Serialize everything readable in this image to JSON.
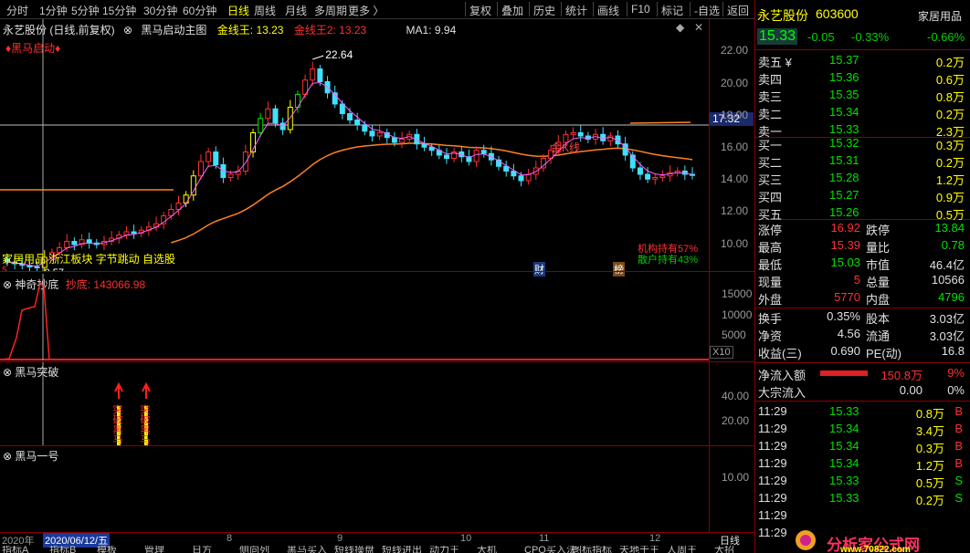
{
  "toolbar": {
    "timeframes": [
      "分时",
      "1分钟",
      "5分钟",
      "15分钟",
      "30分钟",
      "60分钟",
      "日线",
      "周线",
      "月线",
      "多周期",
      "更多 〉"
    ],
    "active_timeframe": "日线",
    "buttons": [
      "复权",
      "叠加",
      "历史",
      "统计",
      "画线",
      "F10",
      "标记",
      "-自选",
      "返回"
    ]
  },
  "main_chart": {
    "title": "永艺股份 (日线,前复权)",
    "indicator_name": "黑马启动主图",
    "gold_line_label": "金线王: 13.23",
    "gold_line2_label": "金线王2: 13.23",
    "ma_label": "MA1: 9.94",
    "start_signal": "♦黑马启动♦",
    "high_label": "22.64",
    "low_label": "9.57",
    "current_price_tag": "17.32",
    "kline_text": "金K线",
    "concepts": "家居用品 浙江板块 字节跳动 自选股",
    "inst_holding": "机构持有57%",
    "retail_holding": "散户持有43%",
    "marker_cai": "财",
    "marker_bang": "榜",
    "marker_s": "s",
    "y_ticks": [
      "22.00",
      "20.00",
      "18.00",
      "16.00",
      "14.00",
      "12.00",
      "10.00"
    ]
  },
  "sub1": {
    "title": "神奇抄底",
    "label": "抄底: 143066.98",
    "y_ticks": [
      "15000",
      "10000",
      "5000"
    ],
    "scale": "X10"
  },
  "sub2": {
    "title": "黑马突破",
    "signal_text": "突破黑马",
    "y_ticks": [
      "40.00",
      "20.00"
    ]
  },
  "sub3": {
    "title": "黑马一号",
    "y_ticks": [
      "10.00"
    ]
  },
  "xaxis": {
    "year": "2020年",
    "cursor_date": "2020/06/12/五",
    "months": [
      "8",
      "9",
      "10",
      "11",
      "12"
    ],
    "period": "日线"
  },
  "bottom_tabs": [
    "指标A",
    "指标B",
    "模板",
    "管理",
    "日方",
    "侧向列",
    "黑马买入",
    "短线操盘",
    "短线进出",
    "动力王",
    "大机",
    "CPO买入法",
    "图标指标",
    "天地于王",
    "人周王",
    "大招"
  ],
  "quote": {
    "name": "永艺股份",
    "code": "603600",
    "industry": "家居用品",
    "price": "15.33",
    "change": "-0.05",
    "change_pct": "-0.33%",
    "industry_pct": "-0.66%",
    "asks": [
      {
        "label": "卖五 ¥",
        "price": "15.37",
        "vol": "0.2万"
      },
      {
        "label": "卖四",
        "price": "15.36",
        "vol": "0.6万"
      },
      {
        "label": "卖三",
        "price": "15.35",
        "vol": "0.8万"
      },
      {
        "label": "卖二",
        "price": "15.34",
        "vol": "0.2万"
      },
      {
        "label": "卖一",
        "price": "15.33",
        "vol": "2.3万"
      }
    ],
    "bids": [
      {
        "label": "买一",
        "price": "15.32",
        "vol": "0.3万"
      },
      {
        "label": "买二",
        "price": "15.31",
        "vol": "0.2万"
      },
      {
        "label": "买三",
        "price": "15.28",
        "vol": "1.2万"
      },
      {
        "label": "买四",
        "price": "15.27",
        "vol": "0.9万"
      },
      {
        "label": "买五",
        "price": "15.26",
        "vol": "0.5万"
      }
    ],
    "stats": [
      {
        "l1": "涨停",
        "v1": "16.92",
        "l2": "跌停",
        "v2": "13.84",
        "c1": "red",
        "c2": "green"
      },
      {
        "l1": "最高",
        "v1": "15.39",
        "l2": "量比",
        "v2": "0.78",
        "c1": "red",
        "c2": "green"
      },
      {
        "l1": "最低",
        "v1": "15.03",
        "l2": "市值",
        "v2": "46.4亿",
        "c1": "green",
        "c2": "white"
      },
      {
        "l1": "现量",
        "v1": "5",
        "l2": "总量",
        "v2": "10566",
        "c1": "red",
        "c2": "white"
      },
      {
        "l1": "外盘",
        "v1": "5770",
        "l2": "内盘",
        "v2": "4796",
        "c1": "red",
        "c2": "green"
      }
    ],
    "stats2": [
      {
        "l1": "换手",
        "v1": "0.35%",
        "l2": "股本",
        "v2": "3.03亿"
      },
      {
        "l1": "净资",
        "v1": "4.56",
        "l2": "流通",
        "v2": "3.03亿"
      },
      {
        "l1": "收益(三)",
        "v1": "0.690",
        "l2": "PE(动)",
        "v2": "16.8"
      }
    ],
    "net_inflow": {
      "label": "净流入额",
      "value": "150.8万",
      "pct": "9%"
    },
    "block_inflow": {
      "label": "大宗流入",
      "value": "0.00",
      "pct": "0%"
    },
    "ticks": [
      {
        "time": "11:29",
        "price": "15.33",
        "vol": "0.8万",
        "side": "B"
      },
      {
        "time": "11:29",
        "price": "15.34",
        "vol": "3.4万",
        "side": "B"
      },
      {
        "time": "11:29",
        "price": "15.34",
        "vol": "0.3万",
        "side": "B"
      },
      {
        "time": "11:29",
        "price": "15.34",
        "vol": "1.2万",
        "side": "B"
      },
      {
        "time": "11:29",
        "price": "15.33",
        "vol": "0.5万",
        "side": "S"
      },
      {
        "time": "11:29",
        "price": "15.33",
        "vol": "0.2万",
        "side": "S"
      },
      {
        "time": "11:29",
        "price": "",
        "vol": "",
        "side": ""
      },
      {
        "time": "11:29",
        "price": "",
        "vol": "",
        "side": ""
      }
    ],
    "watermark": "分析家公式网",
    "watermark_url": "www.70822.com"
  },
  "chart_data": {
    "type": "candlestick",
    "title": "永艺股份 (日线,前复权)",
    "ylim": [
      9,
      23
    ],
    "x_months": [
      "8",
      "9",
      "10",
      "11",
      "12"
    ],
    "closes": [
      9.9,
      9.8,
      9.7,
      9.6,
      9.57,
      10.2,
      10.5,
      10.8,
      11.2,
      11.0,
      11.3,
      11.1,
      11.0,
      11.2,
      11.4,
      11.6,
      11.8,
      11.7,
      11.9,
      12.1,
      12.3,
      12.8,
      13.2,
      13.6,
      14.1,
      15.3,
      16.2,
      16.8,
      16.0,
      15.2,
      15.4,
      15.6,
      16.8,
      18.0,
      18.9,
      19.5,
      18.6,
      18.2,
      19.6,
      20.4,
      21.3,
      22.0,
      21.2,
      20.5,
      19.8,
      19.2,
      18.8,
      18.5,
      18.1,
      17.8,
      18.0,
      17.7,
      17.4,
      17.6,
      17.9,
      17.3,
      17.1,
      16.9,
      16.6,
      16.4,
      16.8,
      16.5,
      16.2,
      16.9,
      16.7,
      16.3,
      15.9,
      15.6,
      15.3,
      15.0,
      15.4,
      15.8,
      16.4,
      16.9,
      17.4,
      17.9,
      18.0,
      17.8,
      17.6,
      17.9,
      17.5,
      17.8,
      17.3,
      16.6,
      15.8,
      15.4,
      15.1,
      15.2,
      15.3,
      15.5,
      15.6,
      15.4,
      15.33
    ]
  }
}
